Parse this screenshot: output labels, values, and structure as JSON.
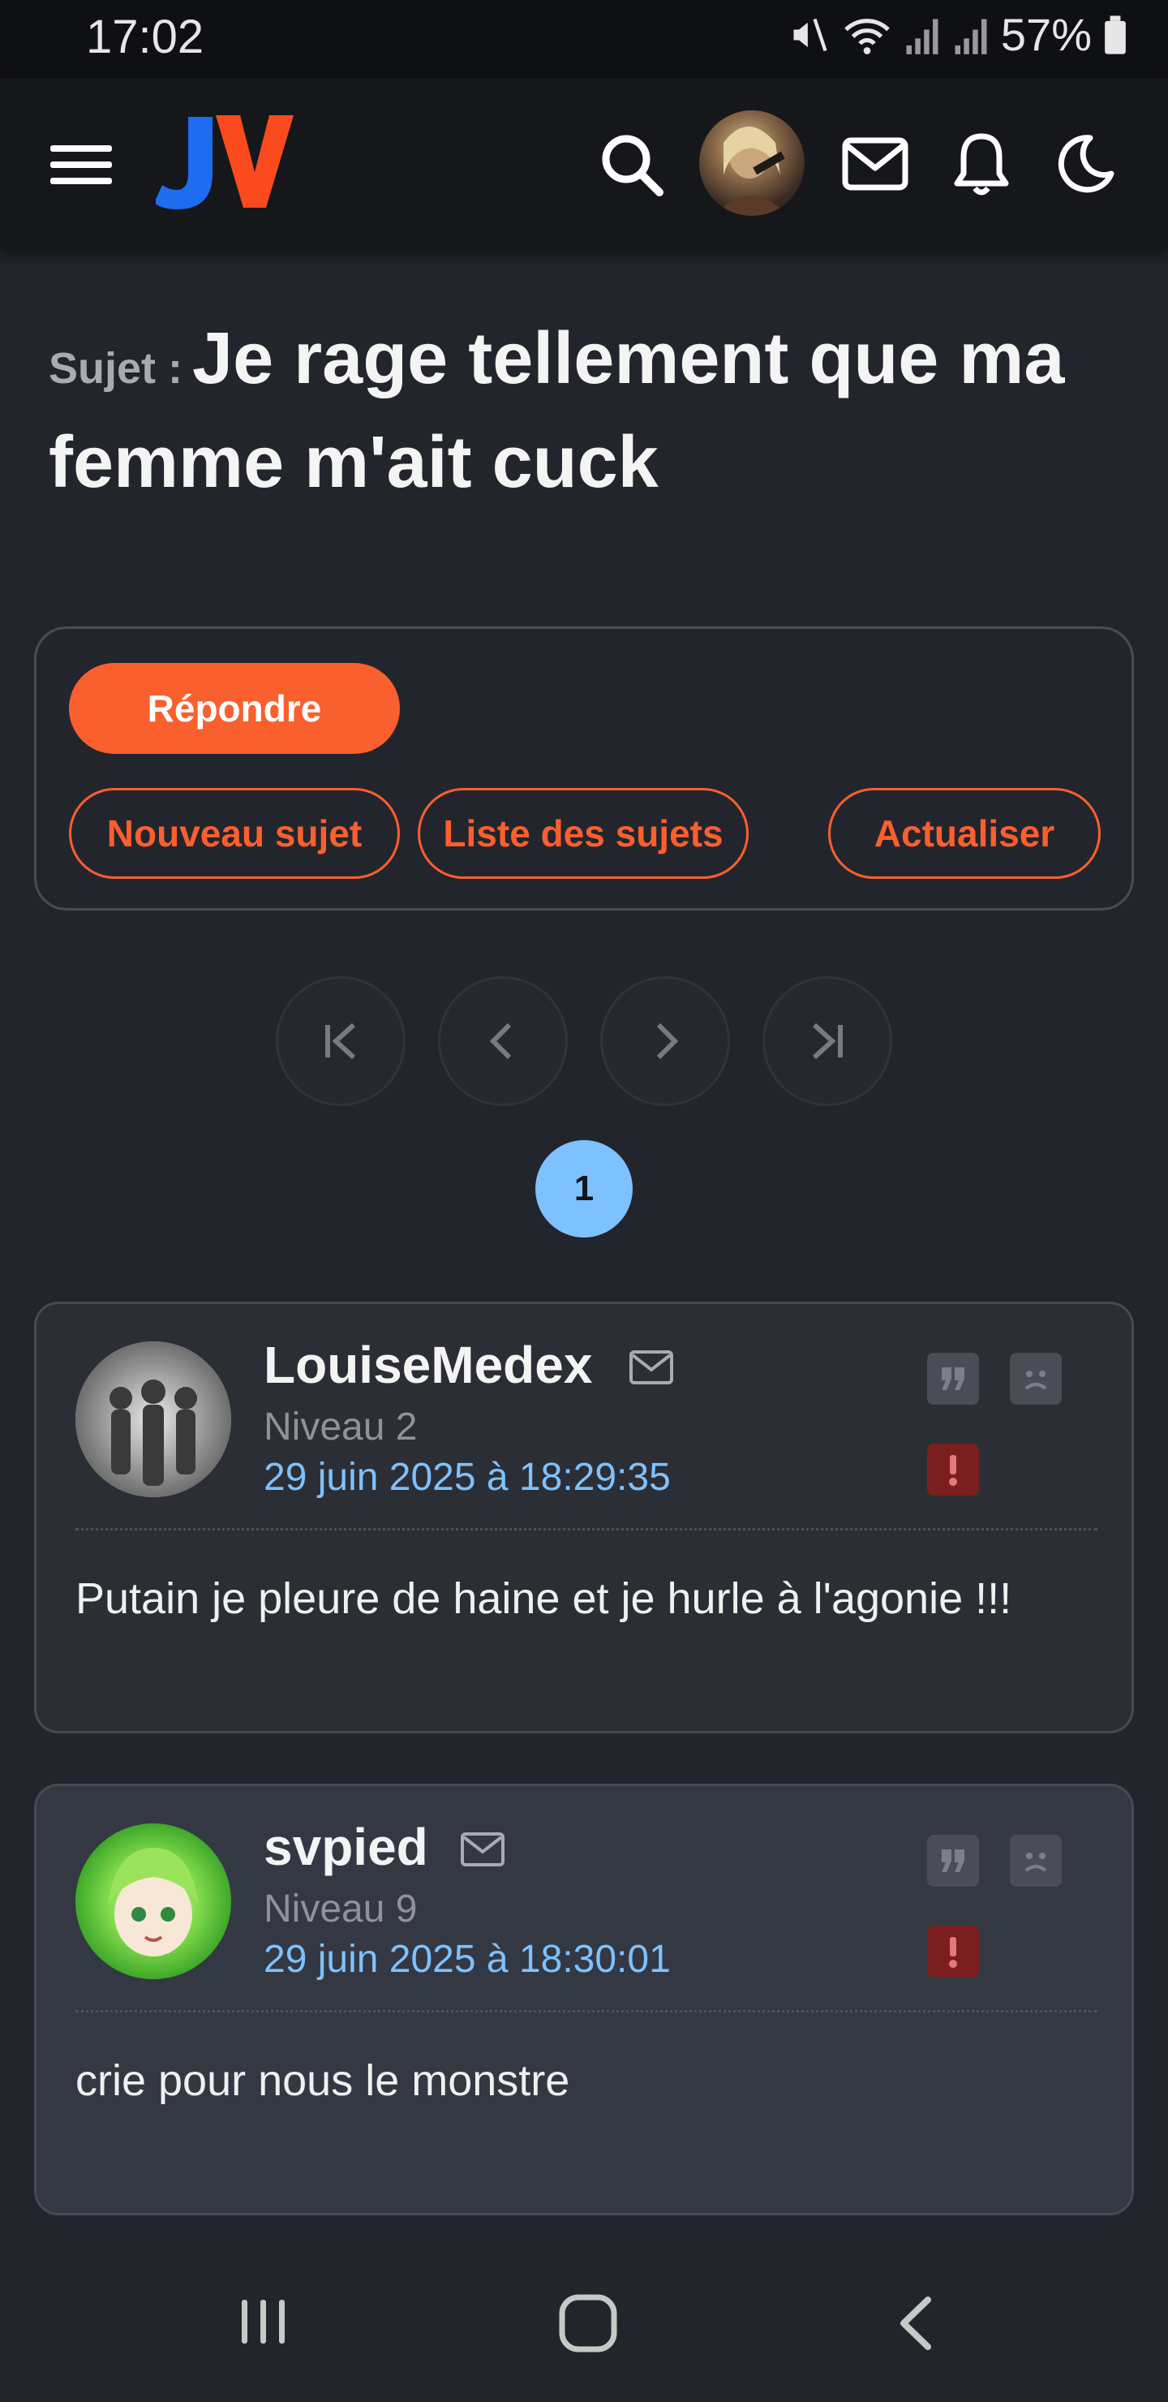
{
  "status_bar": {
    "time": "17:02",
    "battery": "57%"
  },
  "header": {
    "logo_text": "JV",
    "icons": [
      "menu-icon",
      "search-icon",
      "avatar",
      "mail-icon",
      "bell-icon",
      "moon-icon"
    ]
  },
  "topic": {
    "label": "Sujet :",
    "title": "Je rage tellement que ma femme m'ait cuck"
  },
  "actions": {
    "reply": "Répondre",
    "new_topic": "Nouveau sujet",
    "topic_list": "Liste des sujets",
    "refresh": "Actualiser"
  },
  "pagination": {
    "current_page": "1"
  },
  "posts": [
    {
      "author": "LouiseMedex",
      "level": "Niveau 2",
      "date": "29 juin 2025 à 18:29:35",
      "text": "Putain je pleure de haine et je hurle à l'agonie !!!"
    },
    {
      "author": "svpied",
      "level": "Niveau 9",
      "date": "29 juin 2025 à 18:30:01",
      "text": "crie pour nous le monstre"
    }
  ],
  "colors": {
    "accent": "#fa5f2e",
    "link": "#7ec1ff",
    "background": "#23252d"
  }
}
